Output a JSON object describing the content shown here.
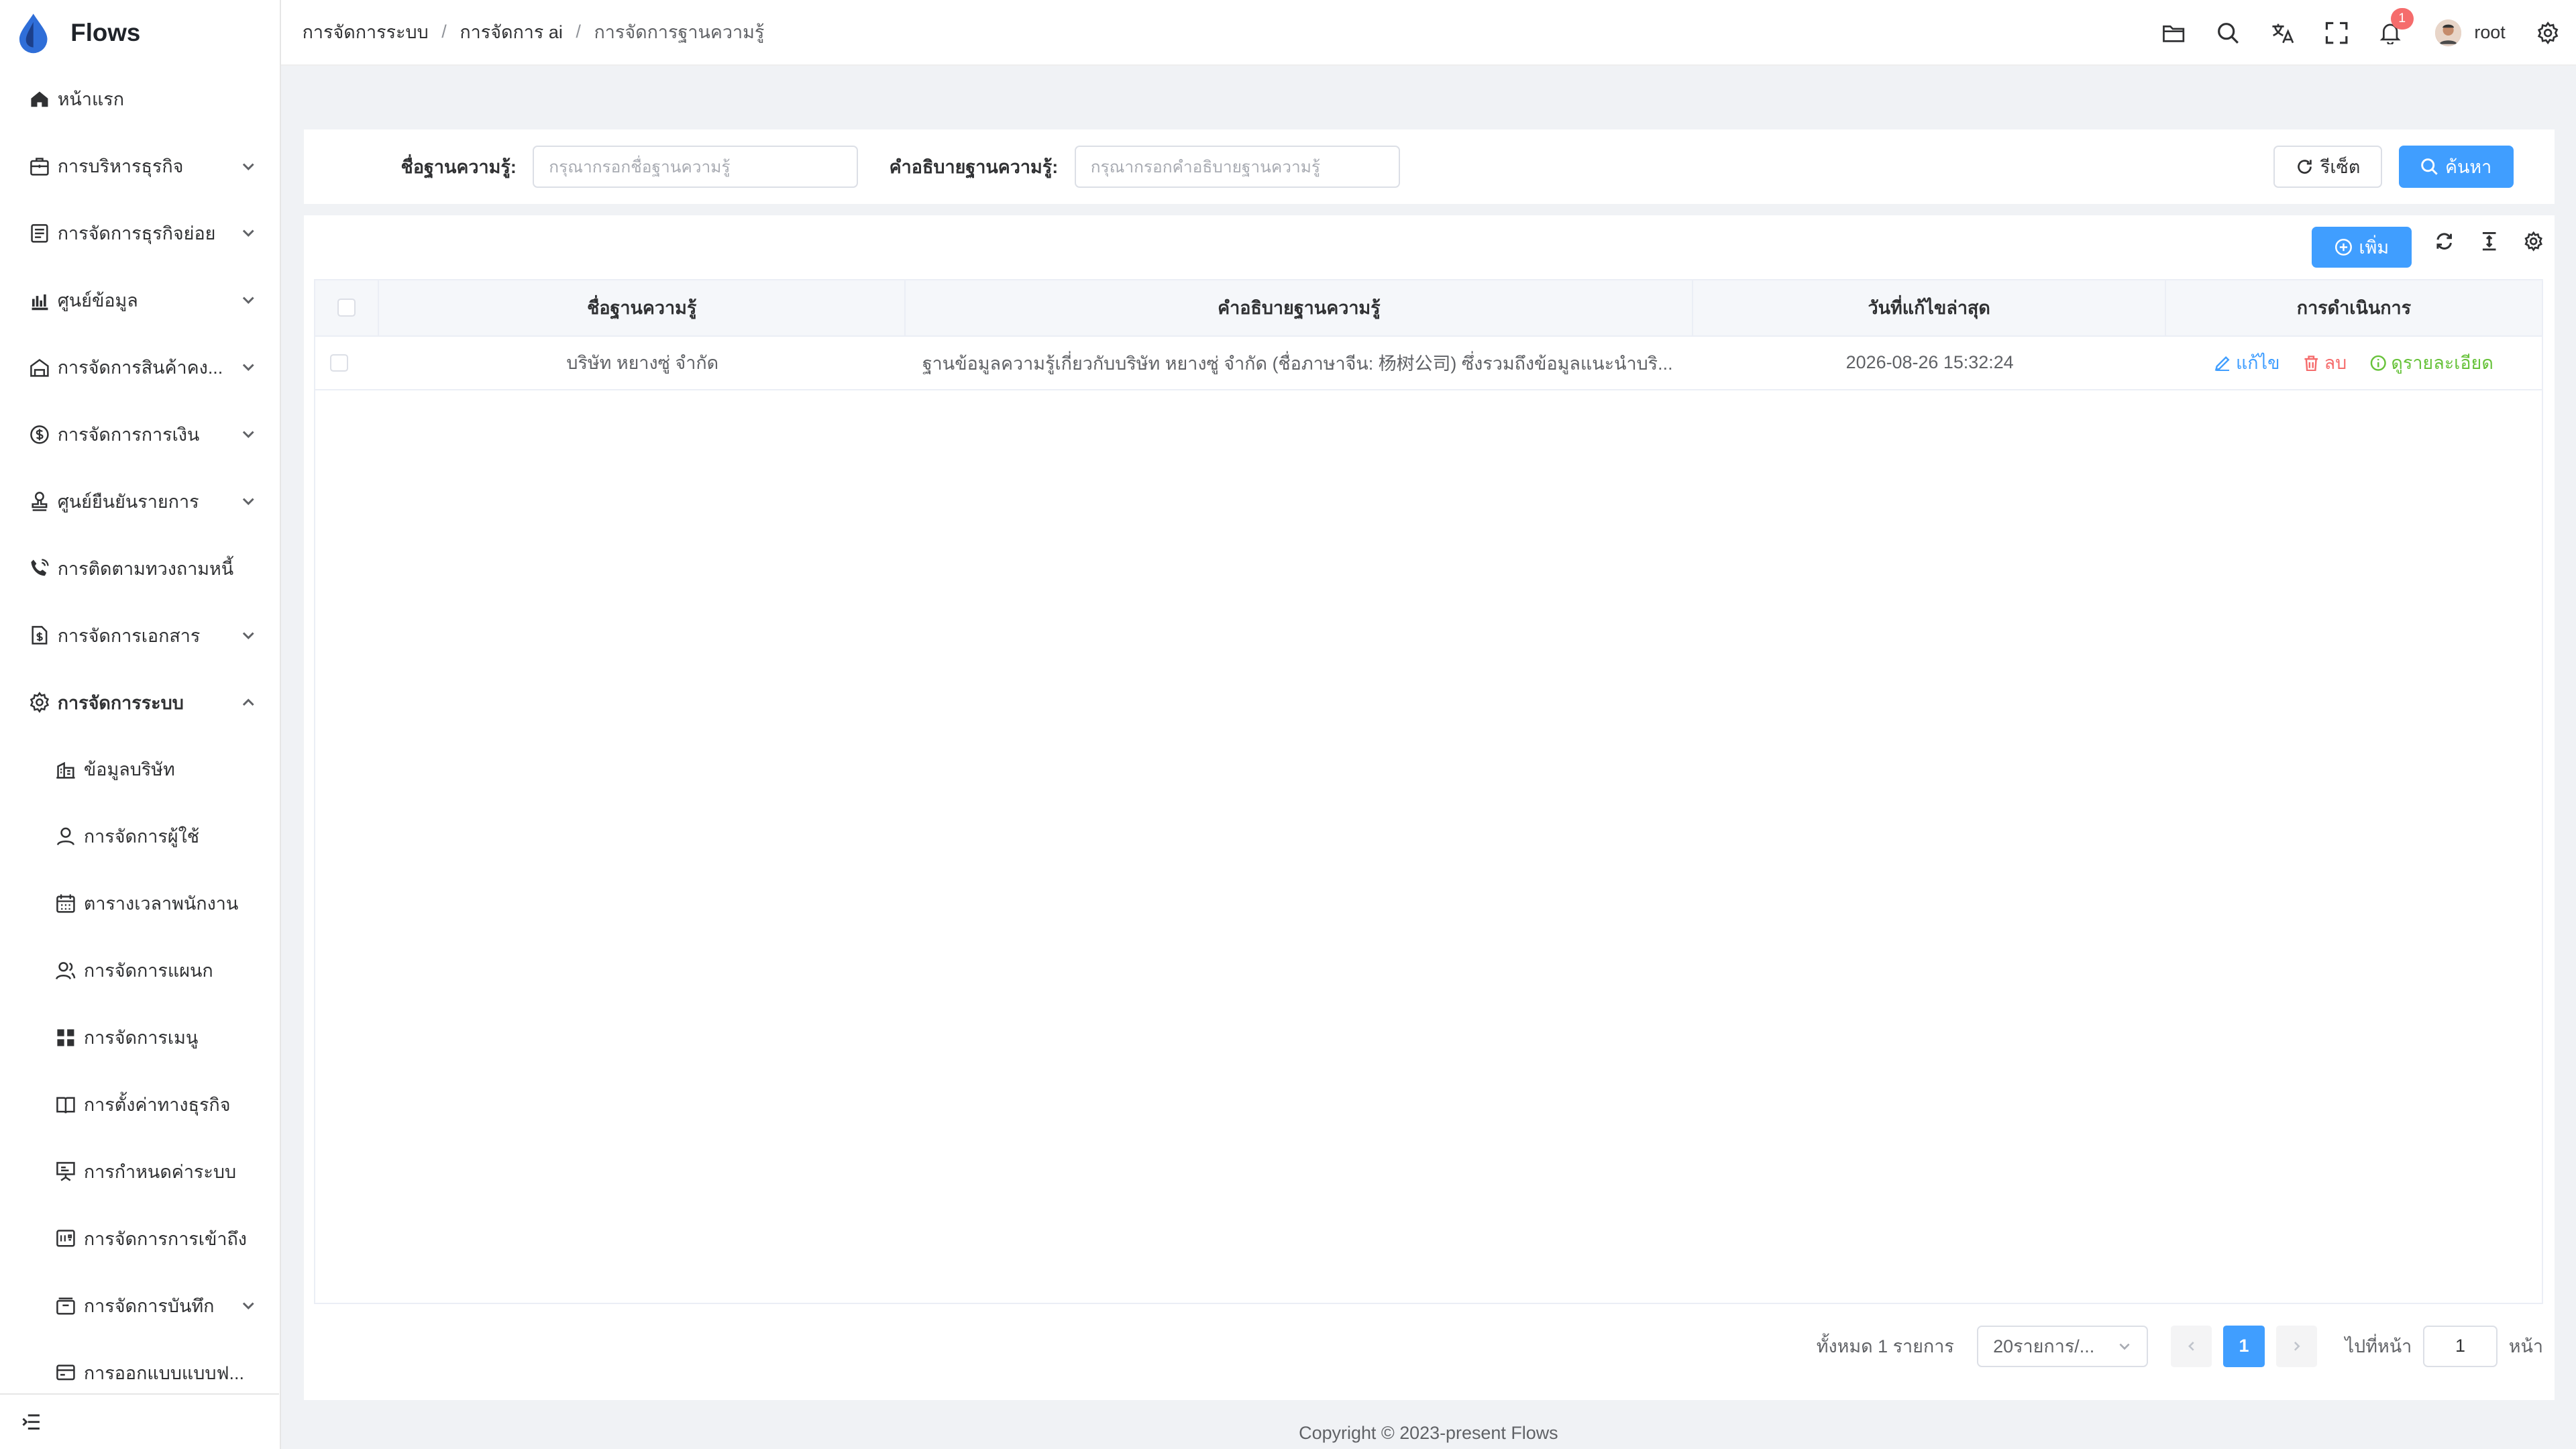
{
  "app": {
    "name": "Flows"
  },
  "sidebar": {
    "items": [
      {
        "label": "หน้าแรก",
        "icon": "home-icon",
        "arrow": false
      },
      {
        "label": "การบริหารธุรกิจ",
        "icon": "briefcase-icon",
        "arrow": true
      },
      {
        "label": "การจัดการธุรกิจย่อย",
        "icon": "document-icon",
        "arrow": true
      },
      {
        "label": "ศูนย์ข้อมูล",
        "icon": "bar-chart-icon",
        "arrow": true
      },
      {
        "label": "การจัดการสินค้าคง...",
        "icon": "warehouse-icon",
        "arrow": true
      },
      {
        "label": "การจัดการการเงิน",
        "icon": "dollar-circle-icon",
        "arrow": true
      },
      {
        "label": "ศูนย์ยืนยันรายการ",
        "icon": "stamp-icon",
        "arrow": true
      },
      {
        "label": "การติดตามทวงถามหนี้",
        "icon": "phone-call-icon",
        "arrow": false
      },
      {
        "label": "การจัดการเอกสาร",
        "icon": "file-dollar-icon",
        "arrow": true
      },
      {
        "label": "การจัดการระบบ",
        "icon": "gear-icon",
        "arrow": true,
        "expanded": true
      }
    ],
    "subitems": [
      {
        "label": "ข้อมูลบริษัท",
        "icon": "building-icon"
      },
      {
        "label": "การจัดการผู้ใช้",
        "icon": "user-icon"
      },
      {
        "label": "ตารางเวลาพนักงาน",
        "icon": "calendar-icon"
      },
      {
        "label": "การจัดการแผนก",
        "icon": "team-icon"
      },
      {
        "label": "การจัดการเมนู",
        "icon": "grid-icon"
      },
      {
        "label": "การตั้งค่าทางธุรกิจ",
        "icon": "book-icon"
      },
      {
        "label": "การกำหนดค่าระบบ",
        "icon": "easel-icon"
      },
      {
        "label": "การจัดการการเข้าถึง",
        "icon": "key-panel-icon"
      },
      {
        "label": "การจัดการบันทึก",
        "icon": "archive-icon",
        "arrow": true
      },
      {
        "label": "การออกแบบแบบฟ...",
        "icon": "form-icon"
      }
    ]
  },
  "header": {
    "breadcrumb": [
      "การจัดการระบบ",
      "การจัดการ ai",
      "การจัดการฐานความรู้"
    ],
    "notification_count": "1",
    "username": "root"
  },
  "search": {
    "name_label": "ชื่อฐานความรู้:",
    "name_placeholder": "กรุณากรอกชื่อฐานความรู้",
    "desc_label": "คำอธิบายฐานความรู้:",
    "desc_placeholder": "กรุณากรอกคำอธิบายฐานความรู้",
    "reset_label": "รีเซ็ต",
    "search_label": "ค้นหา"
  },
  "toolbar": {
    "add_label": "เพิ่ม"
  },
  "table": {
    "columns": [
      "ชื่อฐานความรู้",
      "คำอธิบายฐานความรู้",
      "วันที่แก้ไขล่าสุด",
      "การดำเนินการ"
    ],
    "rows": [
      {
        "name": "บริษัท หยางซู่ จำกัด",
        "description": "ฐานข้อมูลความรู้เกี่ยวกับบริษัท หยางซู่ จำกัด (ชื่อภาษาจีน: 杨树公司) ซึ่งรวมถึงข้อมูลแนะนำบริ...",
        "updated": "2026-08-26 15:32:24",
        "actions": {
          "edit": "แก้ไข",
          "delete": "ลบ",
          "detail": "ดูรายละเอียด"
        }
      }
    ]
  },
  "pagination": {
    "total_text": "ทั้งหมด 1 รายการ",
    "page_size": "20รายการ/...",
    "current_page": "1",
    "goto_label": "ไปที่หน้า",
    "goto_value": "1",
    "page_suffix": "หน้า"
  },
  "footer": {
    "copyright": "Copyright © 2023-present Flows"
  },
  "colors": {
    "primary": "#409eff",
    "danger": "#f56c6c",
    "success": "#67c23a"
  }
}
